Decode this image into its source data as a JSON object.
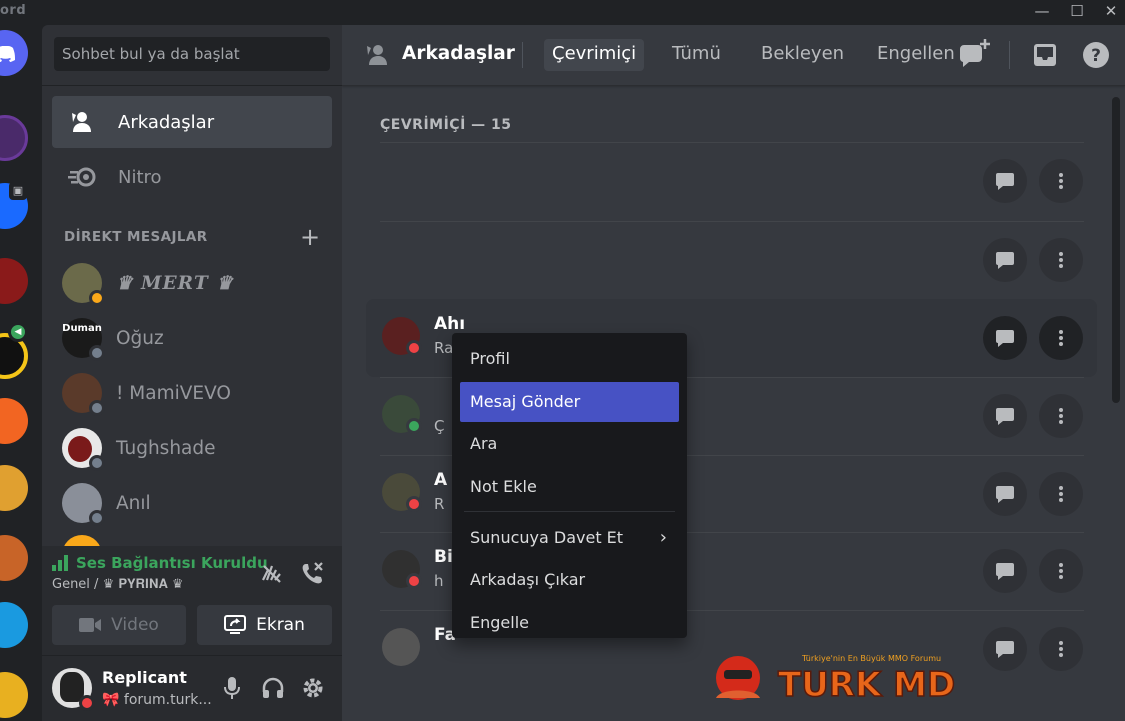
{
  "titlebar": {
    "app_name": "ord",
    "minimize": "—",
    "maximize": "☐",
    "close": "✕"
  },
  "sidebar": {
    "search_placeholder": "Sohbet bul ya da başlat",
    "nav": [
      {
        "label": "Arkadaşlar",
        "icon": "friends-icon"
      },
      {
        "label": "Nitro",
        "icon": "nitro-icon"
      }
    ],
    "dm_header": "DİREKT MESAJLAR",
    "dm_add": "+",
    "dms": [
      {
        "name": "♛ 𝑴𝑬𝑹𝑻 ♛",
        "status": "idle",
        "avatar_color": "#6b6a4a"
      },
      {
        "name": "Oğuz",
        "status": "offline",
        "avatar_color": "#ffffff",
        "avatar_text": "Duman"
      },
      {
        "name": "! MamiVEVO",
        "status": "offline",
        "avatar_color": "#5a3a2a"
      },
      {
        "name": "Tughshade",
        "status": "offline",
        "avatar_color": "#7a1a1a"
      },
      {
        "name": "Anıl",
        "status": "offline",
        "avatar_color": "#8a8f99"
      }
    ]
  },
  "voice": {
    "status": "Ses Bağlantısı Kuruldu",
    "channel": "Genel / ♛ 𝐏𝐘𝐑𝐈𝐍𝐀 ♛",
    "video_label": "Video",
    "screen_label": "Ekran"
  },
  "user": {
    "name": "Replicant",
    "status_text": "forum.turk...",
    "status_emoji": "🎀"
  },
  "topbar": {
    "title": "Arkadaşlar",
    "tabs": [
      "Çevrimiçi",
      "Tümü",
      "Bekleyen",
      "Engellen"
    ],
    "selected_tab": "Çevrimiçi"
  },
  "friends": {
    "online_header": "ÇEVRİMİÇİ — 15",
    "rows": [
      {
        "name": "",
        "sub": "",
        "status": "none"
      },
      {
        "name": "",
        "sub": "",
        "status": "none"
      },
      {
        "name": "Ahı",
        "sub": "Ra",
        "status": "dnd",
        "hover": true
      },
      {
        "name": "",
        "sub": "Ç",
        "status": "online"
      },
      {
        "name": "A",
        "sub": "R",
        "status": "dnd"
      },
      {
        "name": "Bi",
        "sub": "h",
        "status": "dnd"
      },
      {
        "name": "Fa",
        "sub": "",
        "status": "none"
      }
    ]
  },
  "context_menu": {
    "items": [
      "Profil",
      "Mesaj Gönder",
      "Ara",
      "Not Ekle",
      "Sunucuya Davet Et",
      "Arkadaşı Çıkar",
      "Engelle"
    ],
    "selected": "Mesaj Gönder",
    "submenu_item": "Sunucuya Davet Et"
  },
  "watermark": {
    "text": "TURK MD",
    "tagline": "Türkiye'nin En Büyük MMO Forumu"
  },
  "colors": {
    "blurple": "#5865f2",
    "menu_highlight": "#4752c4",
    "green": "#3ba55d",
    "red": "#ed4245",
    "idle": "#faa81a"
  }
}
